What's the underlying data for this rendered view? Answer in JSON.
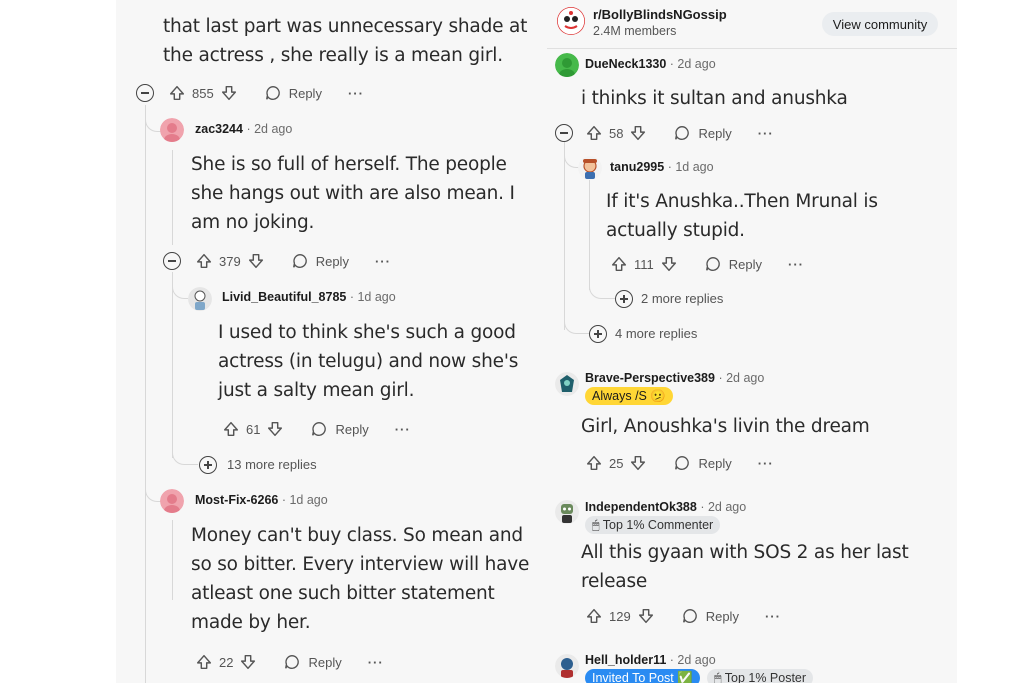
{
  "left": {
    "top_comment": {
      "text_line1": "that last part was unnecessary shade at",
      "text_line2": "the actress , she really is a mean girl.",
      "score": "855",
      "reply_label": "Reply",
      "more_label": "···"
    },
    "comments": [
      {
        "user": "zac3244",
        "time": "· 2d ago",
        "lines": [
          "She is so full of herself. The people",
          "she hangs out with are also mean. I",
          "am no joking."
        ],
        "score": "379",
        "reply_label": "Reply",
        "more_label": "···"
      },
      {
        "user": "Livid_Beautiful_8785",
        "time": "· 1d ago",
        "lines": [
          "I used to think she's such a good",
          "actress (in telugu) and now she's",
          "just a salty mean girl."
        ],
        "score": "61",
        "reply_label": "Reply",
        "more_label": "···"
      },
      {
        "user": "Most-Fix-6266",
        "time": "· 1d ago",
        "lines": [
          "Money can't buy class. So mean and",
          "so so bitter. Every interview will have",
          "atleast one such bitter statement",
          "made by her."
        ],
        "score": "22",
        "reply_label": "Reply",
        "more_label": "···"
      }
    ],
    "more_replies_13": "13 more replies"
  },
  "right": {
    "header": {
      "subreddit": "r/BollyBlindsNGossip",
      "members": "2.4M members",
      "view_community": "View community"
    },
    "comments": [
      {
        "user": "DueNeck1330",
        "time": "· 2d ago",
        "lines": [
          "i thinks it sultan and anushka"
        ],
        "score": "58",
        "reply_label": "Reply",
        "more_label": "···"
      },
      {
        "user": "tanu2995",
        "time": "· 1d ago",
        "lines": [
          "If it's Anushka..Then Mrunal is",
          "actually stupid."
        ],
        "score": "111",
        "reply_label": "Reply",
        "more_label": "···"
      },
      {
        "user": "Brave-Perspective389",
        "time": "· 2d ago",
        "flair": "Always /S 🫤",
        "lines": [
          "Girl, Anoushka's livin the dream"
        ],
        "score": "25",
        "reply_label": "Reply",
        "more_label": "···"
      },
      {
        "user": "IndependentOk388",
        "time": "· 2d ago",
        "flair": "🖱 Top 1% Commenter",
        "lines": [
          "All this gyaan with SOS 2 as her last",
          "release"
        ],
        "score": "129",
        "reply_label": "Reply",
        "more_label": "···"
      },
      {
        "user": "Hell_holder11",
        "time": "· 2d ago",
        "flair": "Invited To Post ✅",
        "flair2": "🖱 Top 1% Poster"
      }
    ],
    "more_replies_2": "2 more replies",
    "more_replies_4": "4 more replies"
  },
  "colors": {
    "panel_bg": "#f7f7f7",
    "pink_avatar": "#f0a3ad",
    "green_avatar": "#46b94a",
    "flair_yellow": "#ffd635",
    "flair_blue": "#2a8bf2"
  }
}
